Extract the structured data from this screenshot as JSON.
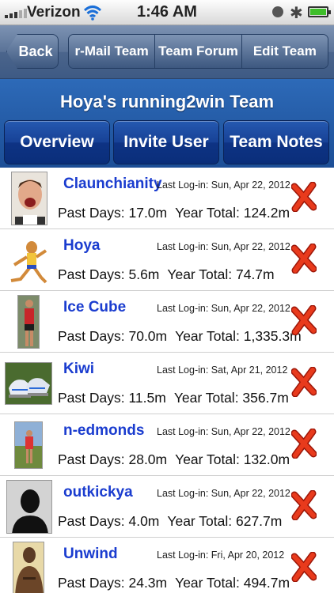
{
  "status_bar": {
    "carrier": "Verizon",
    "time": "1:46 AM"
  },
  "nav": {
    "back_label": "Back",
    "segments": [
      {
        "label": "r-Mail Team"
      },
      {
        "label": "Team Forum"
      },
      {
        "label": "Edit Team"
      }
    ]
  },
  "team": {
    "title": "Hoya's running2win Team",
    "tabs": [
      {
        "label": "Overview"
      },
      {
        "label": "Invite User"
      },
      {
        "label": "Team Notes"
      }
    ]
  },
  "members": [
    {
      "name": "Claunchianity",
      "last_login": "Last Log-in: Sun, Apr 22, 2012",
      "past_days": "Past Days: 17.0m",
      "year_total": "Year Total: 124.2m"
    },
    {
      "name": "Hoya",
      "last_login": "Last Log-in: Sun, Apr 22, 2012",
      "past_days": "Past Days: 5.6m",
      "year_total": "Year Total: 74.7m"
    },
    {
      "name": "Ice Cube",
      "last_login": "Last Log-in: Sun, Apr 22, 2012",
      "past_days": "Past Days: 70.0m",
      "year_total": "Year Total: 1,335.3m"
    },
    {
      "name": "Kiwi",
      "last_login": "Last Log-in: Sat, Apr 21, 2012",
      "past_days": "Past Days: 11.5m",
      "year_total": "Year Total: 356.7m"
    },
    {
      "name": "n-edmonds",
      "last_login": "Last Log-in: Sun, Apr 22, 2012",
      "past_days": "Past Days: 28.0m",
      "year_total": "Year Total: 132.0m"
    },
    {
      "name": "outkickya",
      "last_login": "Last Log-in: Sun, Apr 22, 2012",
      "past_days": "Past Days: 4.0m",
      "year_total": "Year Total: 627.7m"
    },
    {
      "name": "Unwind",
      "last_login": "Last Log-in: Fri, Apr 20, 2012",
      "past_days": "Past Days: 24.3m",
      "year_total": "Year Total: 494.7m"
    }
  ],
  "colors": {
    "nav_blue": "#5a7297",
    "title_band": "#1c4e96",
    "member_name": "#1a3ccf",
    "delete_red": "#e02a14"
  }
}
